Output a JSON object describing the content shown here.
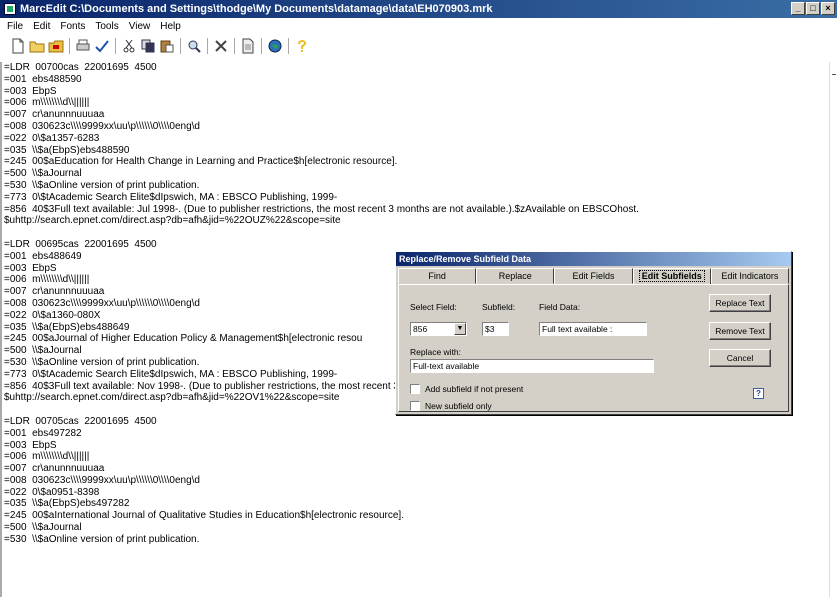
{
  "window": {
    "title": "MarcEdit C:\\Documents and Settings\\thodge\\My Documents\\datamage\\data\\EH070903.mrk",
    "buttons": [
      "_",
      "□",
      "×"
    ]
  },
  "menu": [
    {
      "label": "File"
    },
    {
      "label": "Edit"
    },
    {
      "label": "Fonts"
    },
    {
      "label": "Tools"
    },
    {
      "label": "View"
    },
    {
      "label": "Help"
    }
  ],
  "toolbar": {
    "icons": [
      "new-file-icon",
      "open-folder-icon",
      "print-icon",
      "spellcheck-icon",
      "cut-icon",
      "copy-icon",
      "paste-icon",
      "find-icon",
      "delete-icon",
      "document-icon",
      "globe-icon",
      "help-icon"
    ]
  },
  "records": [
    [
      "=LDR  00700cas  22001695  4500",
      "=001  ebs488590",
      "=003  EbpS",
      "=006  m\\\\\\\\\\\\\\\\d\\\\||||||",
      "=007  cr\\anunnnuuuaa",
      "=008  030623c\\\\\\\\9999xx\\uu\\p\\\\\\\\\\\\0\\\\\\\\0eng\\d",
      "=022  0\\$a1357-6283",
      "=035  \\\\$a(EbpS)ebs488590",
      "=245  00$aEducation for Health Change in Learning and Practice$h[electronic resource].",
      "=500  \\\\$aJournal",
      "=530  \\\\$aOnline version of print publication.",
      "=773  0\\$tAcademic Search Elite$dIpswich, MA : EBSCO Publishing, 1999-",
      "=856  40$3Full text available: Jul 1998-. (Due to publisher restrictions, the most recent 3 months are not available.).$zAvailable on EBSCOhost.",
      "$uhttp://search.epnet.com/direct.asp?db=afh&jid=%22OUZ%22&scope=site"
    ],
    [
      "=LDR  00695cas  22001695  4500",
      "=001  ebs488649",
      "=003  EbpS",
      "=006  m\\\\\\\\\\\\\\\\d\\\\||||||",
      "=007  cr\\anunnnuuuaa",
      "=008  030623c\\\\\\\\9999xx\\uu\\p\\\\\\\\\\\\0\\\\\\\\0eng\\d",
      "=022  0\\$a1360-080X",
      "=035  \\\\$a(EbpS)ebs488649",
      "=245  00$aJournal of Higher Education Policy & Management$h[electronic resou",
      "=500  \\\\$aJournal",
      "=530  \\\\$aOnline version of print publication.",
      "=773  0\\$tAcademic Search Elite$dIpswich, MA : EBSCO Publishing, 1999-",
      "=856  40$3Full text available: Nov 1998-. (Due to publisher restrictions, the most recent 3 months are not available.).$zAvailable on EBSCOhost.",
      "$uhttp://search.epnet.com/direct.asp?db=afh&jid=%22OV1%22&scope=site"
    ],
    [
      "=LDR  00705cas  22001695  4500",
      "=001  ebs497282",
      "=003  EbpS",
      "=006  m\\\\\\\\\\\\\\\\d\\\\||||||",
      "=007  cr\\anunnnuuuaa",
      "=008  030623c\\\\\\\\9999xx\\uu\\p\\\\\\\\\\\\0\\\\\\\\0eng\\d",
      "=022  0\\$a0951-8398",
      "=035  \\\\$a(EbpS)ebs497282",
      "=245  00$aInternational Journal of Qualitative Studies in Education$h[electronic resource].",
      "=500  \\\\$aJournal",
      "=530  \\\\$aOnline version of print publication."
    ]
  ],
  "dialog": {
    "title": "Replace/Remove Subfield Data",
    "tabs": [
      "Find",
      "Replace",
      "Edit Fields",
      "Edit Subfields",
      "Edit Indicators"
    ],
    "active_tab": "Edit Subfields",
    "select_field_label": "Select Field:",
    "select_field_value": "856",
    "subfield_label": "Subfield:",
    "subfield_value": "$3",
    "field_data_label": "Field Data:",
    "field_data_value": "Full text available :",
    "replace_with_label": "Replace with:",
    "replace_with_value": "Full-text available",
    "add_subfield_label": "Add subfield if not present",
    "new_subfield_label": "New subfield only",
    "replace_text_button": "Replace Text",
    "remove_text_button": "Remove Text",
    "cancel_button": "Cancel",
    "help_glyph": "?"
  }
}
